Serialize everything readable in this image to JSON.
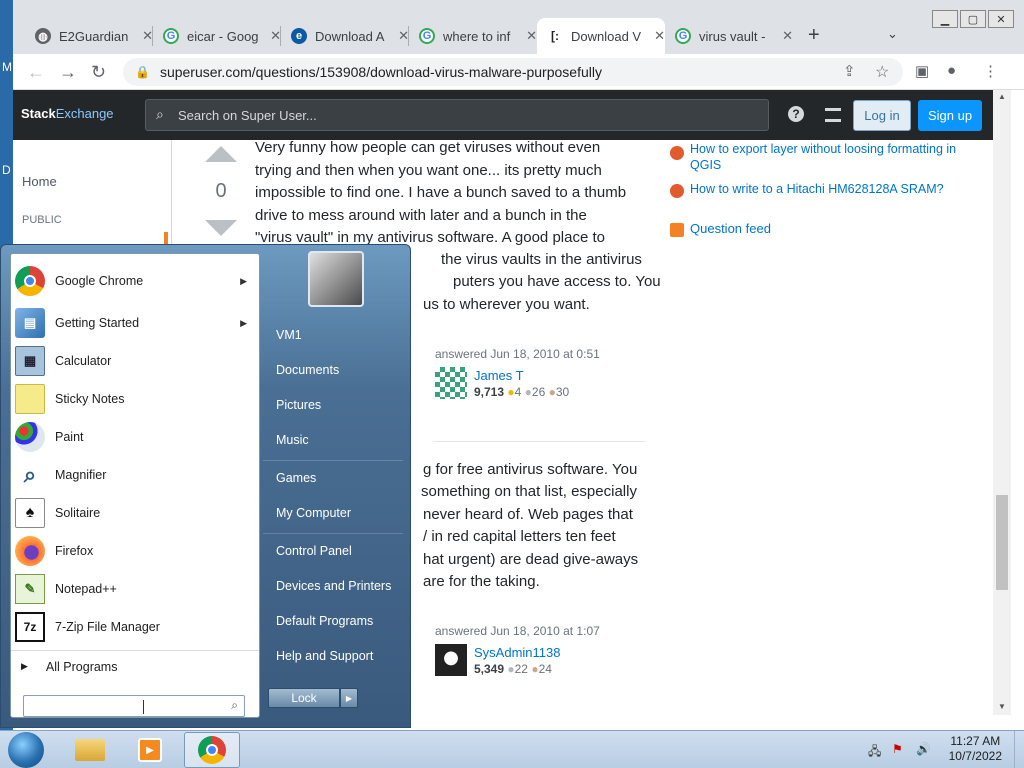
{
  "browser": {
    "tabs": [
      {
        "title": "E2Guardian",
        "icon": "globe-icon"
      },
      {
        "title": "eicar - Goog",
        "icon": "google-icon"
      },
      {
        "title": "Download A",
        "icon": "edge-icon"
      },
      {
        "title": "where to inf",
        "icon": "google-icon"
      },
      {
        "title": "Download V",
        "icon": "superuser-icon",
        "active": true
      },
      {
        "title": "virus vault -",
        "icon": "google-icon"
      }
    ],
    "new_tab": "+",
    "url": "superuser.com/questions/153908/download-virus-malware-purposefully"
  },
  "site": {
    "logo_stack": "Stack",
    "logo_exchange": "Exchange",
    "search_placeholder": "Search on Super User...",
    "login": "Log in",
    "signup": "Sign up"
  },
  "leftnav": {
    "home": "Home",
    "public": "PUBLIC"
  },
  "answer1": {
    "score": "0",
    "lines": [
      "Very funny how people can get viruses without even",
      "trying and then when you want one... its pretty much",
      "impossible to find one. I have a bunch saved to a thumb",
      "drive to mess around with later and a bunch in the",
      "\"virus vault\" in my antivirus software. A good place to",
      "the virus vaults in the antivirus",
      "puters you have access to. You",
      "us to wherever you want."
    ],
    "answered": "answered Jun 18, 2010 at 0:51",
    "user": "James T",
    "rep": "9,713",
    "gold": "4",
    "silver": "26",
    "bronze": "30"
  },
  "answer2": {
    "lines": [
      "g for free antivirus software. You",
      "something on that list, especially",
      "never heard of. Web pages that",
      "/ in red capital letters ten feet",
      "hat urgent) are dead give-aways",
      "are for the taking."
    ],
    "answered": "answered Jun 18, 2010 at 1:07",
    "user": "SysAdmin1138",
    "rep": "5,349",
    "silver": "22",
    "bronze": "24"
  },
  "related": [
    "How to export layer without loosing formatting in QGIS",
    "How to write to a Hitachi HM628128A SRAM?"
  ],
  "question_feed": "Question feed",
  "start_menu": {
    "programs": [
      {
        "label": "Google Chrome",
        "icon": "chrome-icon",
        "arrow": true
      },
      {
        "label": "Getting Started",
        "icon": "getting-started-icon",
        "arrow": true
      },
      {
        "label": "Calculator",
        "icon": "calculator-icon"
      },
      {
        "label": "Sticky Notes",
        "icon": "sticky-notes-icon"
      },
      {
        "label": "Paint",
        "icon": "paint-icon"
      },
      {
        "label": "Magnifier",
        "icon": "magnifier-icon"
      },
      {
        "label": "Solitaire",
        "icon": "solitaire-icon"
      },
      {
        "label": "Firefox",
        "icon": "firefox-icon"
      },
      {
        "label": "Notepad++",
        "icon": "notepadpp-icon"
      },
      {
        "label": "7-Zip File Manager",
        "icon": "7zip-icon"
      }
    ],
    "all_programs": "All Programs",
    "right": [
      "VM1",
      "Documents",
      "Pictures",
      "Music",
      "Games",
      "My Computer",
      "Control Panel",
      "Devices and Printers",
      "Default Programs",
      "Help and Support"
    ],
    "lock": "Lock"
  },
  "taskbar": {
    "time": "11:27 AM",
    "date": "10/7/2022"
  }
}
